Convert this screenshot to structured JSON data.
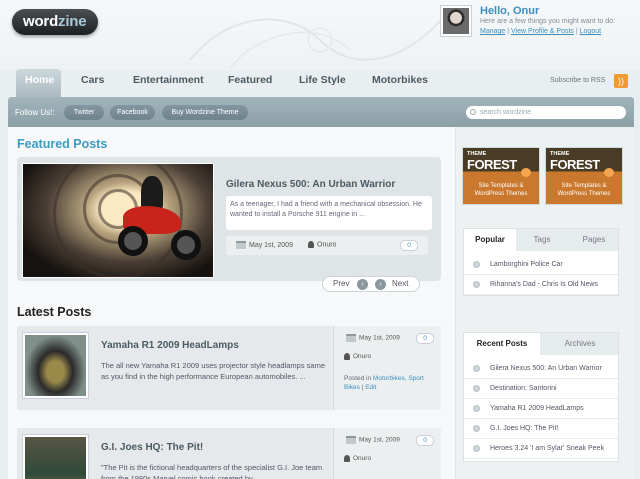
{
  "brand": {
    "logo_part1": "word",
    "logo_part2": "zine"
  },
  "user": {
    "hello": "Hello, Onur",
    "subtext": "Here are a few things you might want to do:",
    "links": [
      "Manage",
      "View Profile & Posts",
      "Logout"
    ],
    "separator": " | "
  },
  "nav": {
    "tabs": [
      "Home",
      "Cars",
      "Entertainment",
      "Featured",
      "Life Style",
      "Motorbikes"
    ],
    "rss_label": "Subscribe to RSS",
    "rss_glyph": "))"
  },
  "toolbar": {
    "follow_label": "Follow Us!:",
    "buttons": [
      "Twitter",
      "Facebook",
      "Buy Wordzine Theme"
    ],
    "search_placeholder": "search wordzine"
  },
  "featured": {
    "heading": "Featured Posts",
    "title": "Gilera Nexus 500: An Urban Warrior",
    "excerpt": "As a teenager, I had a friend with a mechanical obsession. He wanted to install a Porsche 911 engine in ...",
    "date": "May 1st, 2009",
    "author": "Onuro",
    "comments": "0",
    "prev_label": "Prev",
    "next_label": "Next",
    "prev_glyph": "‹",
    "next_glyph": "›"
  },
  "latest": {
    "heading": "Latest Posts",
    "posts": [
      {
        "title": "Yamaha R1 2009 HeadLamps",
        "excerpt": "The all new Yamaha R1 2009 uses projector style headlamps same as you find in the high performance European automobiles. ...",
        "date": "May 1st, 2009",
        "author": "Onuro",
        "comments": "0",
        "posted_in": "Posted in",
        "categories": "Motorbikes, Sport Bikes",
        "edit_sep": " | ",
        "edit": "Edit"
      },
      {
        "title": "G.I. Joes HQ: The Pit!",
        "excerpt": "\"The Pit is the fictional headquarters of the specialist G.I. Joe team from the 1980s Marvel comic book created by ...",
        "date": "May 1st, 2009",
        "author": "Onuro",
        "comments": "0"
      }
    ]
  },
  "ads": [
    {
      "small": "THEME",
      "big": "FOREST",
      "line1": "Site Templates &",
      "line2": "WordPress Themes"
    },
    {
      "small": "THEME",
      "big": "FOREST",
      "line1": "Site Templates &",
      "line2": "WordPress Themes"
    }
  ],
  "sidebar": {
    "tabs1": [
      "Popular",
      "Tags",
      "Pages"
    ],
    "popular": [
      "Lamborghini Police Car",
      "Rihanna's Dad - Chris Is Old News"
    ],
    "tabs2": [
      "Recent Posts",
      "Archives"
    ],
    "recent": [
      "Gilera Nexus 500: An Urban Warrior",
      "Destination: Santorini",
      "Yamaha R1 2009 HeadLamps",
      "G.I. Joes HQ: The Pit!",
      "Heroes 3.24 'I am Sylar' Sneak Peek"
    ]
  },
  "colors": {
    "accent": "#3d9cc3",
    "toolbar": "#98aab2",
    "rss": "#f29a2e"
  }
}
